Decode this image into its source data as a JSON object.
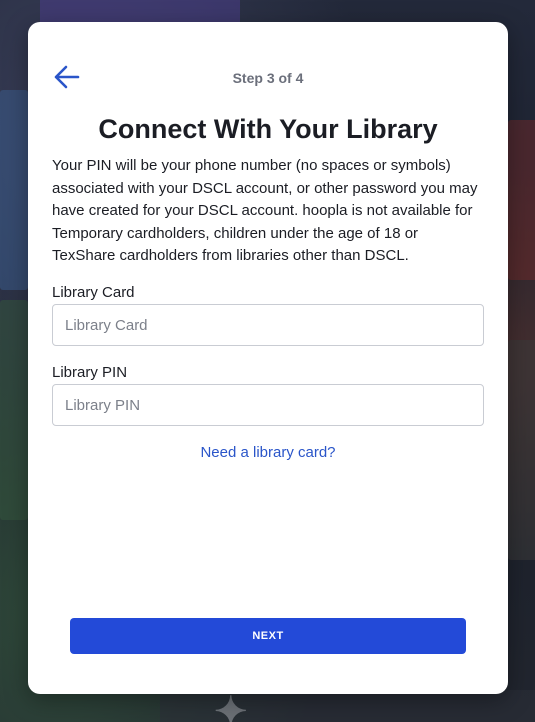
{
  "header": {
    "step": "Step 3 of 4",
    "back_icon": "arrow-left-icon",
    "accent_color": "#2a55c9"
  },
  "title": "Connect With Your Library",
  "description": "Your PIN will be your phone number (no spaces or symbols) associated with your DSCL account, or other password you may have created for your DSCL account. hoopla is not available for Temporary cardholders, children under the age of 18 or TexShare cardholders from libraries other than DSCL.",
  "form": {
    "card": {
      "label": "Library Card",
      "placeholder": "Library Card",
      "value": ""
    },
    "pin": {
      "label": "Library PIN",
      "placeholder": "Library PIN",
      "value": ""
    }
  },
  "help_link": "Need a library card?",
  "next_button": {
    "label": "NEXT",
    "color": "#234ad8"
  }
}
